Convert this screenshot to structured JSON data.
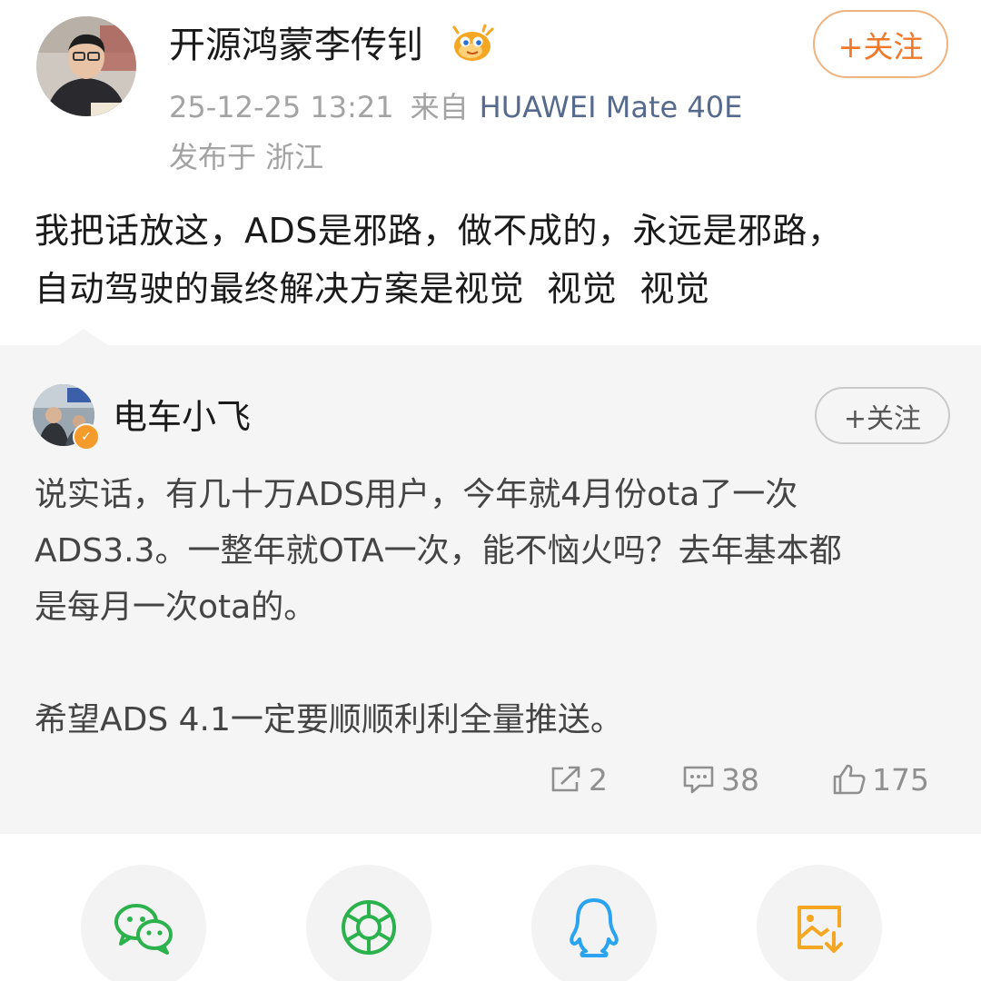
{
  "post": {
    "author": "开源鸿蒙李传钊",
    "follow_label": "+关注",
    "timestamp": "25-12-25 13:21",
    "source_prefix": "来自",
    "device": "HUAWEI Mate 40E",
    "location": "发布于 浙江",
    "text": "我把话放这，ADS是邪路，做不成的，永远是邪路，\n自动驾驶的最终解决方案是视觉  视觉  视觉"
  },
  "repost": {
    "author": "电车小飞",
    "follow_label": "+关注",
    "text": "说实话，有几十万ADS用户，今年就4月份ota了一次\nADS3.3。一整年就OTA一次，能不恼火吗？去年基本都\n是每月一次ota的。\n\n希望ADS 4.1一定要顺顺利利全量推送。",
    "reposts": "2",
    "comments": "38",
    "likes": "175"
  },
  "share": {
    "icons": [
      "wechat-icon",
      "moments-icon",
      "qq-icon",
      "save-image-icon"
    ]
  },
  "colors": {
    "follow_orange": "#f0782a",
    "device_link": "#566a8e",
    "wechat_green": "#2bb24c",
    "qq_blue": "#2aa3f0",
    "save_orange": "#f5a623"
  }
}
